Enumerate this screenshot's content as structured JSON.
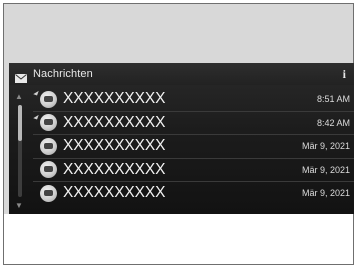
{
  "header": {
    "title": "Nachrichten",
    "icon": "envelope-icon",
    "info_label": "i"
  },
  "messages": [
    {
      "sender": "XXXXXXXXXX",
      "time": "8:51 AM",
      "unread": true
    },
    {
      "sender": "XXXXXXXXXX",
      "time": "8:42 AM",
      "unread": true
    },
    {
      "sender": "XXXXXXXXXX",
      "time": "Mär 9, 2021",
      "unread": false
    },
    {
      "sender": "XXXXXXXXXX",
      "time": "Mär 9, 2021",
      "unread": false
    },
    {
      "sender": "XXXXXXXXXX",
      "time": "Mär 9, 2021",
      "unread": false
    }
  ]
}
